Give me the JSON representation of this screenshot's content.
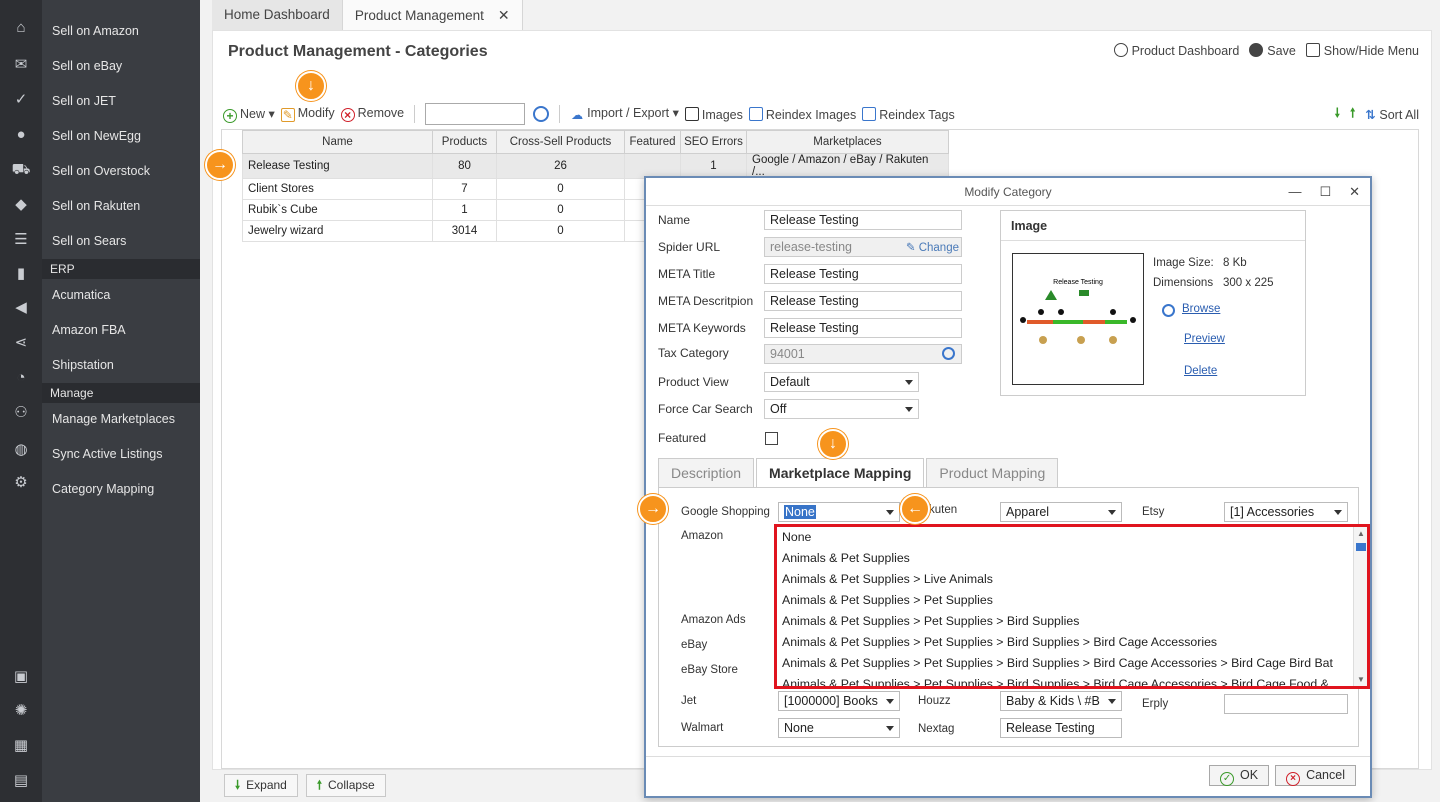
{
  "rail": {
    "icons": [
      "home-icon",
      "mail-icon",
      "check-list-icon",
      "user-icon",
      "cart-icon",
      "tag-icon",
      "sliders-icon",
      "bar-chart-icon",
      "megaphone-icon",
      "share-icon",
      "pie-chart-icon",
      "group-icon",
      "globe-icon",
      "gear-search-icon",
      "layout-icon",
      "lightbulb-icon",
      "dashboard-icon",
      "calendar-icon"
    ]
  },
  "sidebar": {
    "items_top": [
      "Sell on Amazon",
      "Sell on eBay",
      "Sell on JET",
      "Sell on NewEgg",
      "Sell on Overstock",
      "Sell on Rakuten",
      "Sell on Sears"
    ],
    "section_erp": "ERP",
    "items_erp": [
      "Acumatica",
      "Amazon FBA",
      "Shipstation"
    ],
    "section_manage": "Manage",
    "items_manage": [
      "Manage Marketplaces",
      "Sync Active Listings",
      "Category Mapping"
    ]
  },
  "tabs": {
    "home": "Home Dashboard",
    "product": "Product Management"
  },
  "page": {
    "title": "Product Management - Categories",
    "actions": {
      "dashboard": "Product Dashboard",
      "save": "Save",
      "showhide": "Show/Hide Menu"
    }
  },
  "toolbar": {
    "new": "New",
    "modify": "Modify",
    "remove": "Remove",
    "import_export": "Import / Export",
    "images": "Images",
    "reindex_images": "Reindex Images",
    "reindex_tags": "Reindex Tags",
    "sort_all": "Sort All"
  },
  "grid": {
    "columns": [
      "Name",
      "Products",
      "Cross-Sell Products",
      "Featured",
      "SEO Errors",
      "Marketplaces"
    ],
    "rows": [
      {
        "name": "Release Testing",
        "products": "80",
        "cross": "26",
        "featured": "",
        "seo": "1",
        "markets": "Google / Amazon / eBay / Rakuten /..."
      },
      {
        "name": "Client Stores",
        "products": "7",
        "cross": "0",
        "featured": "",
        "seo": "",
        "markets": ""
      },
      {
        "name": "Rubik`s Cube",
        "products": "1",
        "cross": "0",
        "featured": "",
        "seo": "",
        "markets": ""
      },
      {
        "name": "Jewelry wizard",
        "products": "3014",
        "cross": "0",
        "featured": "",
        "seo": "",
        "markets": ""
      }
    ]
  },
  "bottom": {
    "expand": "Expand",
    "collapse": "Collapse"
  },
  "dialog": {
    "title": "Modify Category",
    "labels": {
      "name": "Name",
      "spider": "Spider URL",
      "meta_title": "META Title",
      "meta_desc": "META Descritpion",
      "meta_keys": "META Keywords",
      "tax": "Tax Category",
      "view": "Product View",
      "force": "Force Car Search",
      "featured": "Featured"
    },
    "values": {
      "name": "Release Testing",
      "spider": "release-testing",
      "change": "Change",
      "meta_title": "Release Testing",
      "meta_desc": "Release Testing",
      "meta_keys": "Release Testing",
      "tax": "94001",
      "view": "Default",
      "force": "Off"
    },
    "image": {
      "header": "Image",
      "size_label": "Image Size:",
      "size_value": "8 Kb",
      "dim_label": "Dimensions",
      "dim_value": "300 x 225",
      "browse": "Browse",
      "preview": "Preview",
      "delete": "Delete",
      "thumb_title": "Release Testing"
    },
    "tabs": [
      "Description",
      "Marketplace Mapping",
      "Product Mapping"
    ],
    "mapping": {
      "google_label": "Google Shopping",
      "google_value": "None",
      "rakuten_label": "kuten",
      "rakuten_value": "Apparel",
      "etsy_label": "Etsy",
      "etsy_value": "[1] Accessories",
      "amazon_label": "Amazon",
      "amazon_ads_label": "Amazon Ads",
      "ebay_label": "eBay",
      "ebay_store_label": "eBay Store",
      "jet_label": "Jet",
      "jet_value": "[1000000] Books",
      "houzz_label": "Houzz",
      "houzz_value": "Baby & Kids \\ #B",
      "erply_label": "Erply",
      "walmart_label": "Walmart",
      "walmart_value": "None",
      "nextag_label": "Nextag",
      "nextag_value": "Release Testing"
    },
    "dropdown_options": [
      "None",
      "Animals & Pet Supplies",
      "Animals & Pet Supplies > Live Animals",
      "Animals & Pet Supplies > Pet Supplies",
      "Animals & Pet Supplies > Pet Supplies > Bird Supplies",
      "Animals & Pet Supplies > Pet Supplies > Bird Supplies > Bird Cage Accessories",
      "Animals & Pet Supplies > Pet Supplies > Bird Supplies > Bird Cage Accessories > Bird Cage Bird Bat",
      "Animals & Pet Supplies > Pet Supplies > Bird Supplies > Bird Cage Accessories > Bird Cage Food &"
    ],
    "ok": "OK",
    "cancel": "Cancel"
  },
  "colors": {
    "accent": "#f7941d",
    "highlight_border": "#e0141e",
    "select_blue": "#3874c8"
  }
}
